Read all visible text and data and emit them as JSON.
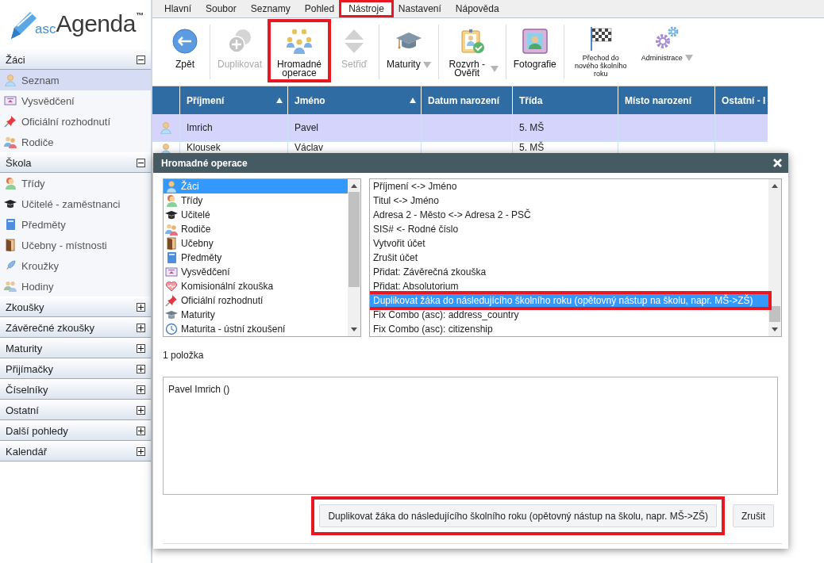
{
  "logo": {
    "prefix": "asc",
    "name": "Agenda",
    "mark": "™"
  },
  "sidebar": {
    "sections": [
      {
        "title": "Žáci",
        "expanded": true,
        "items": [
          {
            "label": "Seznam",
            "selected": true
          },
          {
            "label": "Vysvědčení",
            "selected": false
          },
          {
            "label": "Oficiální rozhodnutí",
            "selected": false
          },
          {
            "label": "Rodiče",
            "selected": false
          }
        ]
      },
      {
        "title": "Škola",
        "expanded": true,
        "items": [
          {
            "label": "Třídy",
            "selected": false
          },
          {
            "label": "Učitelé - zaměstnanci",
            "selected": false
          },
          {
            "label": "Předměty",
            "selected": false
          },
          {
            "label": "Učebny - místnosti",
            "selected": false
          },
          {
            "label": "Kroužky",
            "selected": false
          },
          {
            "label": "Hodiny",
            "selected": false
          }
        ]
      },
      {
        "title": "Zkoušky",
        "expanded": false
      },
      {
        "title": "Závěrečné zkoušky",
        "expanded": false
      },
      {
        "title": "Maturity",
        "expanded": false
      },
      {
        "title": "Přijímačky",
        "expanded": false
      },
      {
        "title": "Číselníky",
        "expanded": false
      },
      {
        "title": "Ostatní",
        "expanded": false
      },
      {
        "title": "Další pohledy",
        "expanded": false
      },
      {
        "title": "Kalendář",
        "expanded": false
      }
    ]
  },
  "menu": [
    {
      "label": "Hlavní",
      "selected": false,
      "highlighted": false
    },
    {
      "label": "Soubor",
      "selected": false,
      "highlighted": false
    },
    {
      "label": "Seznamy",
      "selected": false,
      "highlighted": false
    },
    {
      "label": "Pohled",
      "selected": false,
      "highlighted": false
    },
    {
      "label": "Nástroje",
      "selected": true,
      "highlighted": true
    },
    {
      "label": "Nastavení",
      "selected": false,
      "highlighted": false
    },
    {
      "label": "Nápověda",
      "selected": false,
      "highlighted": false
    }
  ],
  "toolbar": {
    "groups": [
      [
        {
          "label": "Zpět",
          "kind": "large",
          "dropdown": false,
          "disabled": false,
          "highlighted": false
        }
      ],
      [
        {
          "label": "Duplikovat",
          "kind": "large",
          "dropdown": false,
          "disabled": true,
          "highlighted": false
        },
        {
          "label": "Hromadné operace",
          "kind": "large",
          "dropdown": false,
          "disabled": false,
          "highlighted": true
        },
        {
          "label": "Setřiď",
          "kind": "large",
          "dropdown": false,
          "disabled": true,
          "highlighted": false
        }
      ],
      [
        {
          "label": "Maturity",
          "kind": "large",
          "dropdown": true,
          "disabled": false,
          "highlighted": false
        }
      ],
      [
        {
          "label": "Rozvrh - Ověřit",
          "kind": "large",
          "dropdown": true,
          "disabled": false,
          "highlighted": false
        }
      ],
      [
        {
          "label": "Fotografie",
          "kind": "large",
          "dropdown": false,
          "disabled": false,
          "highlighted": false
        }
      ],
      [
        {
          "label": "Přechod do nového školního roku",
          "kind": "small",
          "dropdown": false,
          "disabled": false,
          "highlighted": false
        },
        {
          "label": "Administrace",
          "kind": "small",
          "dropdown": true,
          "disabled": false,
          "highlighted": false
        }
      ]
    ]
  },
  "table": {
    "columns": [
      {
        "label": "Příjmení",
        "sorted": true
      },
      {
        "label": "Jméno",
        "sorted": true
      },
      {
        "label": "Datum narození",
        "sorted": false
      },
      {
        "label": "Třída",
        "sorted": false
      },
      {
        "label": "Místo narození",
        "sorted": false
      },
      {
        "label": "Ostatní - I",
        "sorted": false
      }
    ],
    "rows": [
      {
        "selected": true,
        "surname": "Imrich",
        "first_name": "Pavel",
        "class": "5. MŠ"
      },
      {
        "selected": false,
        "surname": "Klousek",
        "first_name": "Václav",
        "class": "5. MŠ"
      }
    ]
  },
  "dialog": {
    "title": "Hromadné operace",
    "categories": [
      {
        "label": "Žáci",
        "selected": true
      },
      {
        "label": "Třídy",
        "selected": false
      },
      {
        "label": "Učitelé",
        "selected": false
      },
      {
        "label": "Rodiče",
        "selected": false
      },
      {
        "label": "Učebny",
        "selected": false
      },
      {
        "label": "Předměty",
        "selected": false
      },
      {
        "label": "Vysvědčení",
        "selected": false
      },
      {
        "label": "Komisionální zkouška",
        "selected": false
      },
      {
        "label": "Oficiální rozhodnutí",
        "selected": false
      },
      {
        "label": "Maturity",
        "selected": false
      },
      {
        "label": "Maturita - ústní zkoušení",
        "selected": false
      }
    ],
    "operations": [
      {
        "label": "Příjmení <-> Jméno",
        "selected": false,
        "highlighted": false
      },
      {
        "label": "Titul <-> Jméno",
        "selected": false,
        "highlighted": false
      },
      {
        "label": "Adresa 2 - Město <-> Adresa 2 - PSČ",
        "selected": false,
        "highlighted": false
      },
      {
        "label": "SIS# <- Rodné číslo",
        "selected": false,
        "highlighted": false
      },
      {
        "label": "Vytvořit účet",
        "selected": false,
        "highlighted": false
      },
      {
        "label": "Zrušit účet",
        "selected": false,
        "highlighted": false
      },
      {
        "label": "Přidat: Závěrečná zkouška",
        "selected": false,
        "highlighted": false
      },
      {
        "label": "Přidat: Absolutorium",
        "selected": false,
        "highlighted": false
      },
      {
        "label": "Duplikovat žáka do následujícího školního roku (opětovný nástup na školu, napr. MŠ->ZŠ)",
        "selected": true,
        "highlighted": true
      },
      {
        "label": "Fix Combo (asc): address_country",
        "selected": false,
        "highlighted": false
      },
      {
        "label": "Fix Combo (asc): citizenship",
        "selected": false,
        "highlighted": false
      }
    ],
    "count": "1 položka",
    "selection_text": "Pavel Imrich ()",
    "buttons": [
      {
        "label": "Duplikovat žáka do následujícího školního roku (opětovný nástup na školu, napr. MŠ->ZŠ)",
        "highlighted": true
      },
      {
        "label": "Zrušit",
        "highlighted": false
      }
    ]
  }
}
